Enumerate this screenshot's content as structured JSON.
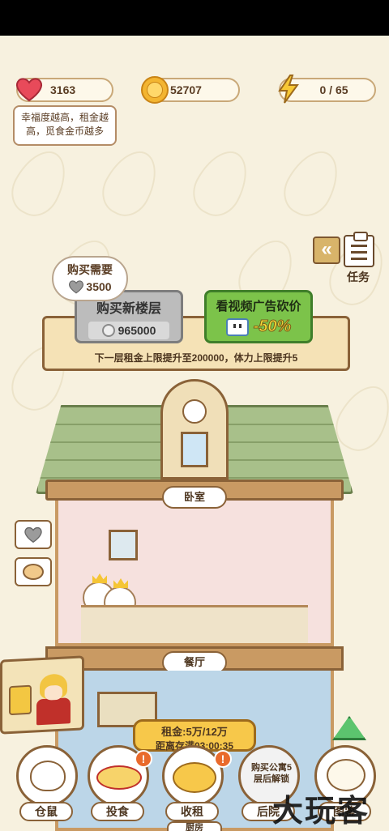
{
  "stats": {
    "happiness": "3163",
    "coins": "52707",
    "energy": "0 / 65"
  },
  "tip": "幸福度越高，租金越高，觅食金币越多",
  "tasks": {
    "label": "任务"
  },
  "purchase_requirement": {
    "title": "购买需要",
    "hearts": "3500"
  },
  "buy_floor": {
    "label": "购买新楼层",
    "price": "965000"
  },
  "ad_discount": {
    "label": "看视频广告砍价",
    "discount": "-50%"
  },
  "upgrade_info": "下一层租金上限提升至200000，体力上限提升5",
  "rooms": {
    "bedroom": "卧室",
    "dining": "餐厅"
  },
  "rent": {
    "amount": "租金:5万/12万",
    "timer": "距离存满03:00:35"
  },
  "bottom_nav": [
    {
      "label": "仓鼠"
    },
    {
      "label": "投食"
    },
    {
      "label": "收租"
    },
    {
      "label": "后院",
      "locked_text": "购买公寓5层后解锁"
    },
    {
      "label": "图鉴"
    }
  ],
  "under_room": "厨房",
  "alerts": [
    "!",
    "!"
  ],
  "watermark": "大玩客",
  "colors": {
    "background": "#f7f1df",
    "heart": "#e84a5a",
    "coin": "#f3b531",
    "ad_green": "#7cc34a",
    "rent_yellow": "#f7c84a"
  }
}
